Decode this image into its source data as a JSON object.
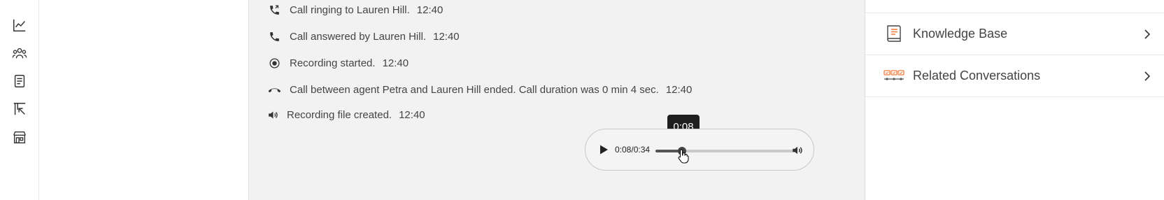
{
  "left_rail": {
    "icons": [
      "analytics-icon",
      "team-icon",
      "document-icon",
      "reports-icon",
      "store-icon"
    ]
  },
  "timeline": {
    "events": [
      {
        "icon": "call-forward-icon",
        "text": "Call ringing to Lauren Hill.",
        "time": "12:40"
      },
      {
        "icon": "phone-icon",
        "text": "Call answered by Lauren Hill.",
        "time": "12:40"
      },
      {
        "icon": "record-icon",
        "text": "Recording started.",
        "time": "12:40"
      },
      {
        "icon": "hang-up-icon",
        "text": "Call between agent Petra and Lauren Hill ended. Call duration was 0 min 4 sec.",
        "time": "12:40"
      },
      {
        "icon": "speaker-icon",
        "text": "Recording file created.",
        "time": "12:40"
      }
    ]
  },
  "audio_player": {
    "time_display": "0:08/0:34",
    "tooltip": "0:08",
    "progress_fraction": 0.19,
    "buttons": [
      "play-icon",
      "volume-icon"
    ]
  },
  "side_panel": {
    "items": [
      {
        "label": "Knowledge Base",
        "icon": "book-icon"
      },
      {
        "label": "Related Conversations",
        "icon": "conversations-icon"
      }
    ]
  },
  "colors": {
    "accent": "#f07a3a",
    "feed_background": "#f2f2f2",
    "tooltip_background": "#1e1e1e"
  }
}
